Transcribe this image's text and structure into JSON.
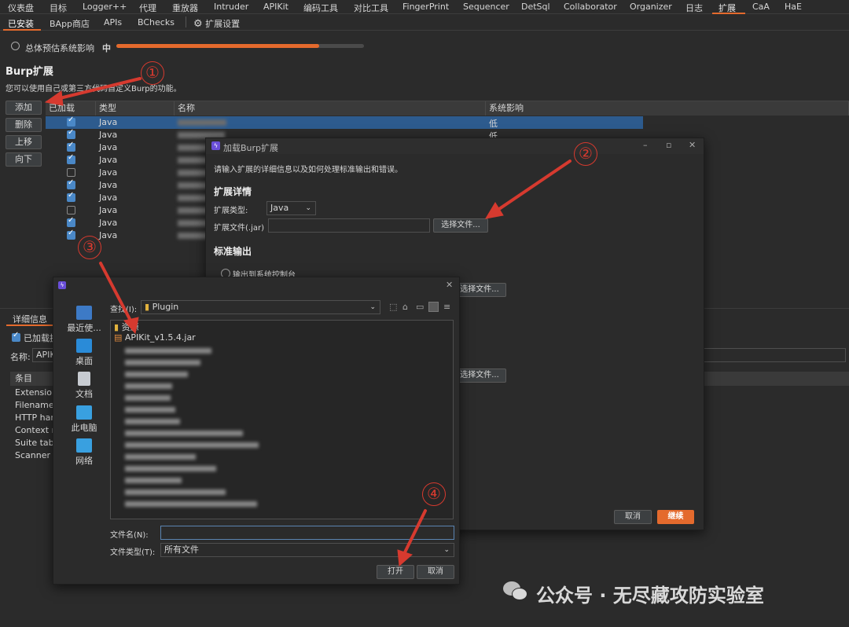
{
  "topnav": {
    "items": [
      "仪表盘",
      "目标",
      "Logger++",
      "代理",
      "Intruder",
      "重放器",
      "Intruder",
      "APIKit",
      "编码工具",
      "对比工具",
      "FingerPrint",
      "Sequencer",
      "DetSql",
      "Collaborator",
      "Organizer",
      "日志",
      "扩展",
      "CaA",
      "HaE"
    ],
    "active": "扩展"
  },
  "subnav": {
    "items": [
      "已安装",
      "BApp商店",
      "APIs",
      "BChecks",
      "扩展设置"
    ]
  },
  "impact": {
    "label": "总体预估系统影响",
    "level": "中",
    "fraction": 0.82
  },
  "section": {
    "title": "Burp扩展",
    "desc": "您可以使用自己或第三方代码自定义Burp的功能。"
  },
  "buttons": {
    "add": "添加",
    "delete": "删除",
    "up": "上移",
    "down": "向下"
  },
  "table": {
    "headers": [
      "已加载",
      "类型",
      "名称",
      "系统影响"
    ],
    "rows": [
      {
        "loaded": true,
        "type": "Java",
        "impact": "低"
      },
      {
        "loaded": true,
        "type": "Java",
        "impact": "低"
      },
      {
        "loaded": true,
        "type": "Java",
        "impact": ""
      },
      {
        "loaded": true,
        "type": "Java",
        "impact": ""
      },
      {
        "loaded": false,
        "type": "Java",
        "impact": ""
      },
      {
        "loaded": true,
        "type": "Java",
        "impact": ""
      },
      {
        "loaded": true,
        "type": "Java",
        "impact": ""
      },
      {
        "loaded": false,
        "type": "Java",
        "impact": ""
      },
      {
        "loaded": true,
        "type": "Java",
        "impact": ""
      },
      {
        "loaded": true,
        "type": "Java",
        "impact": ""
      }
    ]
  },
  "details": {
    "tab": "详细信息",
    "loaded_label": "已加载扩",
    "name_label": "名称:",
    "name_value": "APIK",
    "list_header": "条目",
    "items": [
      "Extension",
      "Filename",
      "HTTP han",
      "Context m",
      "Suite tabs",
      "Scanner c"
    ]
  },
  "load_dialog": {
    "title": "加载Burp扩展",
    "intro": "请输入扩展的详细信息以及如何处理标准输出和错误。",
    "details_heading": "扩展详情",
    "type_label": "扩展类型:",
    "type_value": "Java",
    "file_label": "扩展文件(.jar)",
    "choose_file": "选择文件...",
    "stdout_heading": "标准输出",
    "stdout_option": "输出到系统控制台",
    "cancel": "取消",
    "continue": "继续"
  },
  "file_dialog": {
    "lookin_label": "查找(I):",
    "folder": "Plugin",
    "places": [
      "最近使...",
      "桌面",
      "文档",
      "此电脑",
      "网络"
    ],
    "first_folder": "资源",
    "selected_file": "APIKit_v1.5.4.jar",
    "filename_label": "文件名(N):",
    "filetype_label": "文件类型(T):",
    "filetype_value": "所有文件",
    "open": "打开",
    "cancel": "取消"
  },
  "annotations": [
    "①",
    "②",
    "③",
    "④"
  ],
  "watermark": "公众号 · 无尽藏攻防实验室",
  "colors": {
    "accent": "#e46a2d",
    "selection": "#2d5b8e",
    "check": "#4a88c7",
    "annotation": "#d63a2f"
  }
}
